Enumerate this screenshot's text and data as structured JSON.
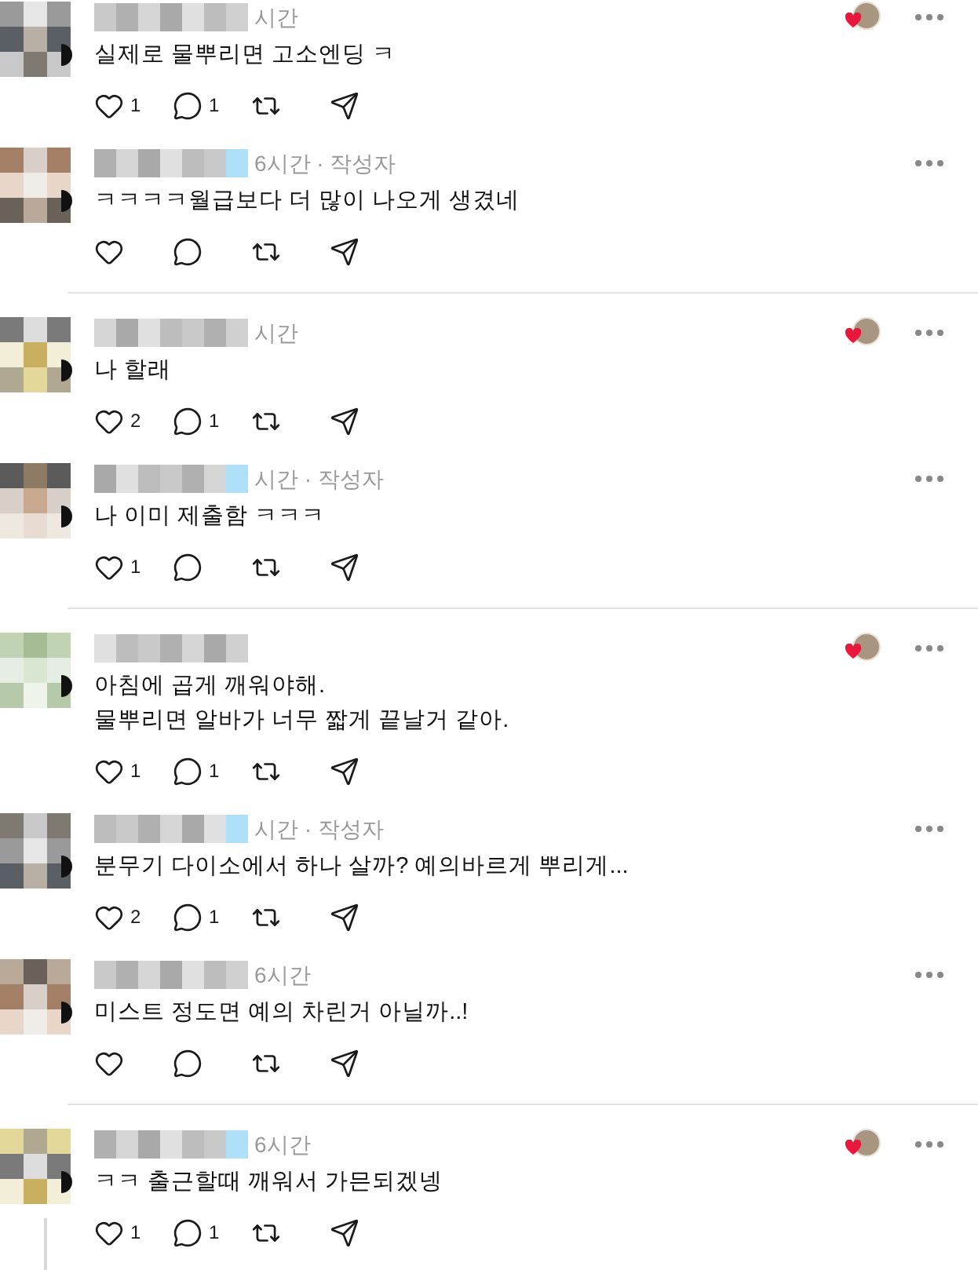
{
  "comments": [
    {
      "time": "시간",
      "text": "실제로 물뿌리면 고소엔딩 ㅋ",
      "likes": "1",
      "replies": "1",
      "liked_by_author": true,
      "divider_after": false,
      "thread_line": false
    },
    {
      "time": "6시간 · 작성자",
      "text": "ㅋㅋㅋㅋ월급보다 더 많이 나오게 생겼네",
      "liked_by_author": false,
      "divider_after": true,
      "thread_line": false
    },
    {
      "time": "시간",
      "text": "나 할래",
      "likes": "2",
      "replies": "1",
      "liked_by_author": true,
      "divider_after": false,
      "thread_line": false
    },
    {
      "time": "시간 · 작성자",
      "text": "나 이미 제출함 ㅋㅋㅋ",
      "likes": "1",
      "liked_by_author": false,
      "divider_after": true,
      "thread_line": false
    },
    {
      "text": "아침에 곱게 깨워야해.\n물뿌리면 알바가 너무 짧게 끝날거 같아.",
      "likes": "1",
      "replies": "1",
      "liked_by_author": true,
      "divider_after": false,
      "thread_line": false
    },
    {
      "time": "시간 · 작성자",
      "text": "분무기 다이소에서 하나 살까? 예의바르게 뿌리게...",
      "likes": "2",
      "replies": "1",
      "liked_by_author": false,
      "divider_after": false,
      "thread_line": false
    },
    {
      "time": "6시간",
      "text": "미스트 정도면 예의 차린거 아닐까..!",
      "liked_by_author": false,
      "divider_after": true,
      "thread_line": false
    },
    {
      "time": "6시간",
      "text": "ㅋㅋ 출근할때 깨워서 가믄되겠넹",
      "likes": "1",
      "replies": "1",
      "liked_by_author": true,
      "divider_after": false,
      "thread_line": true
    }
  ]
}
